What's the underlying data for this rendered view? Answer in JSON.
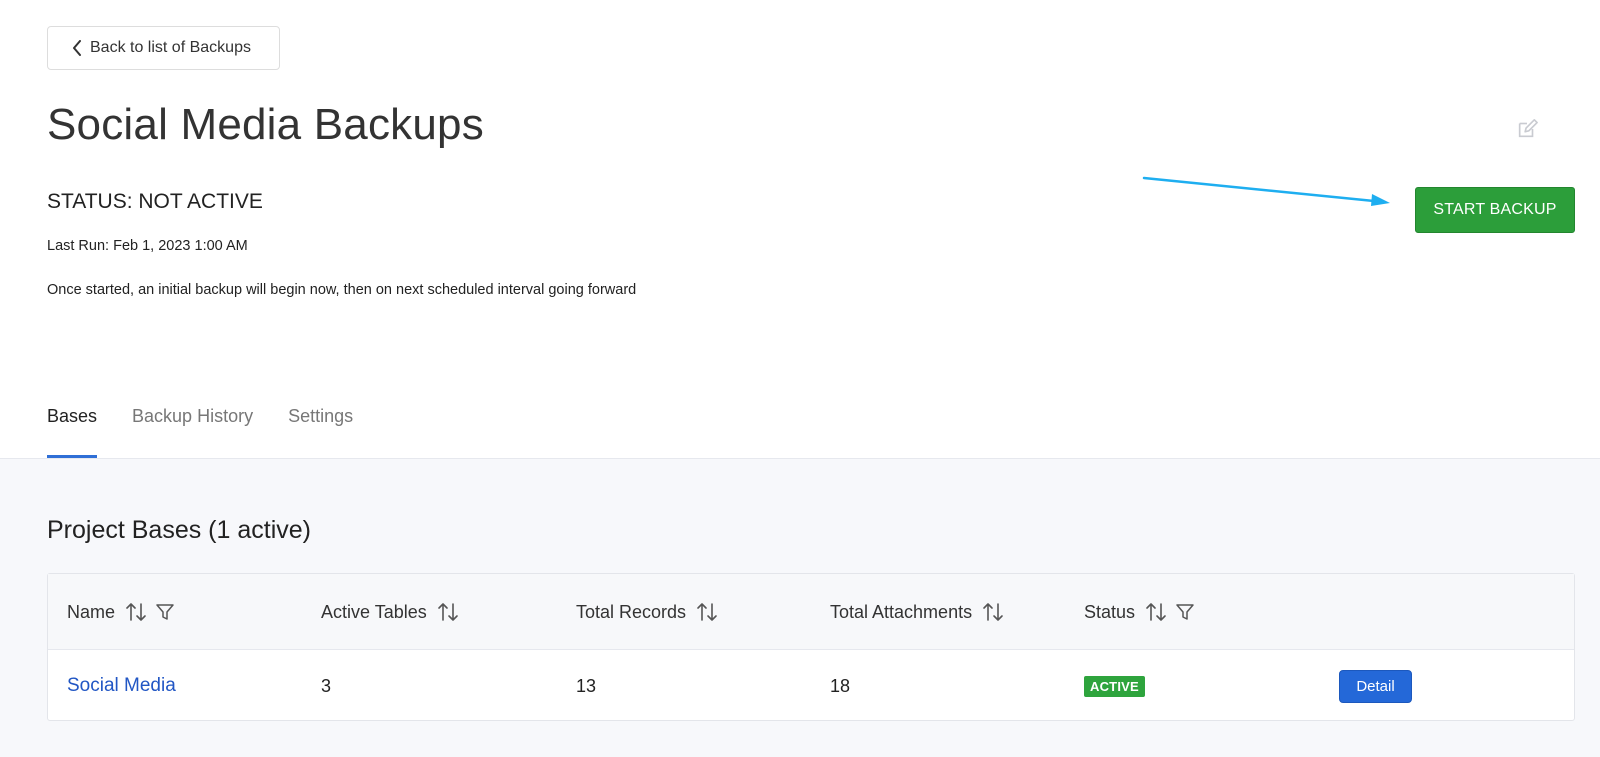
{
  "header": {
    "back_label": "Back to list of Backups",
    "title": "Social Media Backups",
    "status_text": "STATUS: NOT ACTIVE",
    "last_run": "Last Run: Feb 1, 2023 1:00 AM",
    "note": "Once started, an initial backup will begin now, then on next scheduled interval going forward",
    "start_button_label": "START BACKUP"
  },
  "tabs": [
    {
      "label": "Bases",
      "active": true
    },
    {
      "label": "Backup History",
      "active": false
    },
    {
      "label": "Settings",
      "active": false
    }
  ],
  "section": {
    "title": "Project Bases (1 active)"
  },
  "table": {
    "columns": [
      "Name",
      "Active Tables",
      "Total Records",
      "Total Attachments",
      "Status"
    ],
    "rows": [
      {
        "name": "Social Media",
        "active_tables": "3",
        "total_records": "13",
        "total_attachments": "18",
        "status": "ACTIVE",
        "action": "Detail"
      }
    ]
  },
  "colors": {
    "accent_green": "#2c9e3a",
    "accent_blue": "#2468d8",
    "tab_underline": "#2f6fd6",
    "annotation_arrow": "#1eaef0"
  },
  "icons": [
    "chevron-left-icon",
    "edit-icon",
    "sort-icon",
    "filter-icon",
    "arrow-annotation"
  ]
}
